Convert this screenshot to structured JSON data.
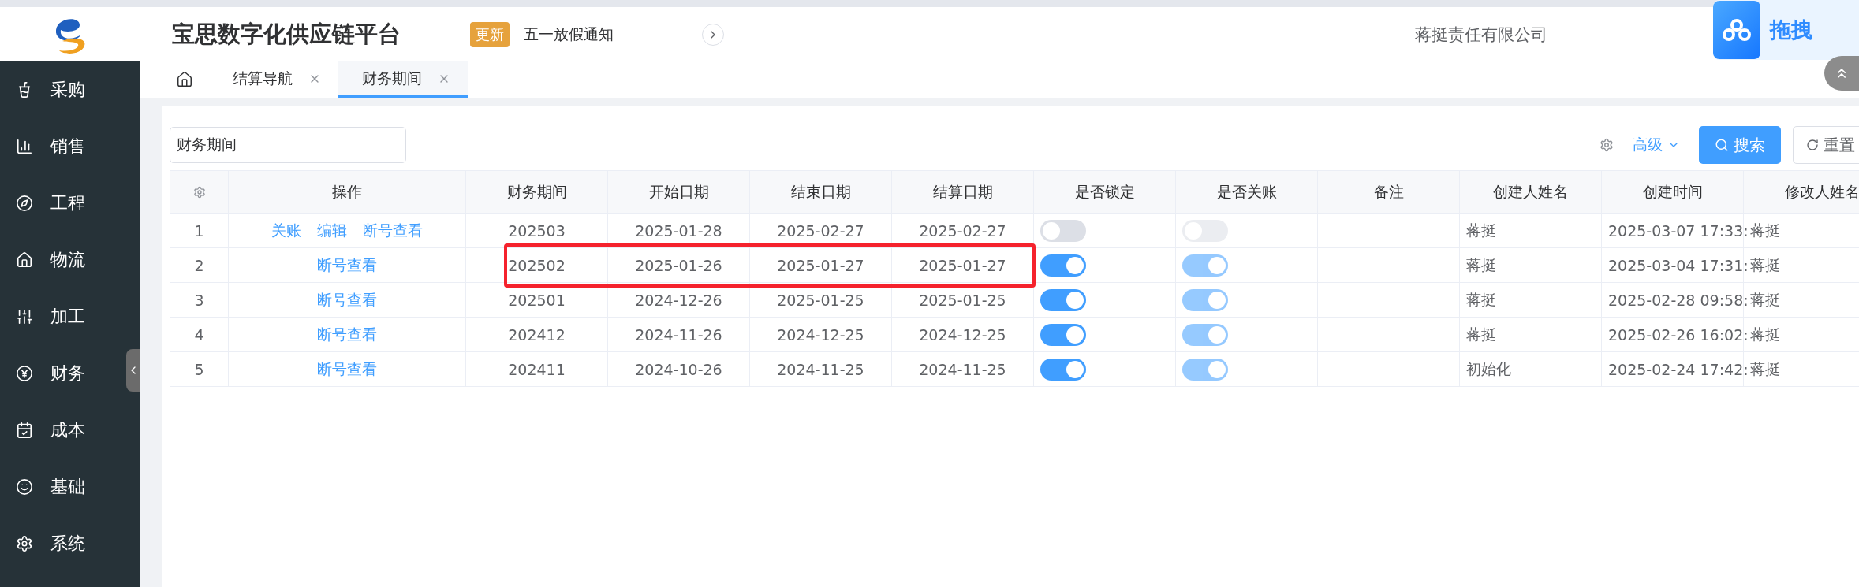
{
  "header": {
    "title": "宝思数字化供应链平台",
    "notice": {
      "badge": "更新",
      "text": "五一放假通知"
    },
    "company": "蒋挺责任有限公司",
    "drag_widget": {
      "label": "拖拽"
    }
  },
  "sidebar": {
    "items": [
      {
        "label": "采购"
      },
      {
        "label": "销售"
      },
      {
        "label": "工程"
      },
      {
        "label": "物流"
      },
      {
        "label": "加工"
      },
      {
        "label": "财务"
      },
      {
        "label": "成本"
      },
      {
        "label": "基础"
      },
      {
        "label": "系统"
      }
    ]
  },
  "tabs": [
    {
      "label": "结算导航",
      "selected": false
    },
    {
      "label": "财务期间",
      "selected": true
    }
  ],
  "filter": {
    "value": "财务期间",
    "advanced": "高级",
    "search": "搜索",
    "reset": "重置"
  },
  "table": {
    "columns": [
      "操作",
      "财务期间",
      "开始日期",
      "结束日期",
      "结算日期",
      "是否锁定",
      "是否关账",
      "备注",
      "创建人姓名",
      "创建时间",
      "修改人姓名"
    ],
    "closed_switch_disabled": true,
    "rows": [
      {
        "index": "1",
        "actions": [
          "关账",
          "编辑",
          "断号查看"
        ],
        "period": "202503",
        "start": "2025-01-28",
        "end": "2025-02-27",
        "settle": "2025-02-27",
        "locked": false,
        "closed": false,
        "creator": "蒋挺",
        "created": "2025-03-07 17:33:",
        "modifier": "蒋挺",
        "highlighted": false
      },
      {
        "index": "2",
        "actions": [
          "断号查看"
        ],
        "period": "202502",
        "start": "2025-01-26",
        "end": "2025-01-27",
        "settle": "2025-01-27",
        "locked": true,
        "closed": true,
        "creator": "蒋挺",
        "created": "2025-03-04 17:31:",
        "modifier": "蒋挺",
        "highlighted": true
      },
      {
        "index": "3",
        "actions": [
          "断号查看"
        ],
        "period": "202501",
        "start": "2024-12-26",
        "end": "2025-01-25",
        "settle": "2025-01-25",
        "locked": true,
        "closed": true,
        "creator": "蒋挺",
        "created": "2025-02-28 09:58:",
        "modifier": "蒋挺",
        "highlighted": false
      },
      {
        "index": "4",
        "actions": [
          "断号查看"
        ],
        "period": "202412",
        "start": "2024-11-26",
        "end": "2024-12-25",
        "settle": "2024-12-25",
        "locked": true,
        "closed": true,
        "creator": "蒋挺",
        "created": "2025-02-26 16:02:",
        "modifier": "蒋挺",
        "highlighted": false
      },
      {
        "index": "5",
        "actions": [
          "断号查看"
        ],
        "period": "202411",
        "start": "2024-10-26",
        "end": "2024-11-25",
        "settle": "2024-11-25",
        "locked": true,
        "closed": true,
        "creator": "初始化",
        "created": "2025-02-24 17:42:",
        "modifier": "蒋挺",
        "highlighted": false
      }
    ]
  }
}
